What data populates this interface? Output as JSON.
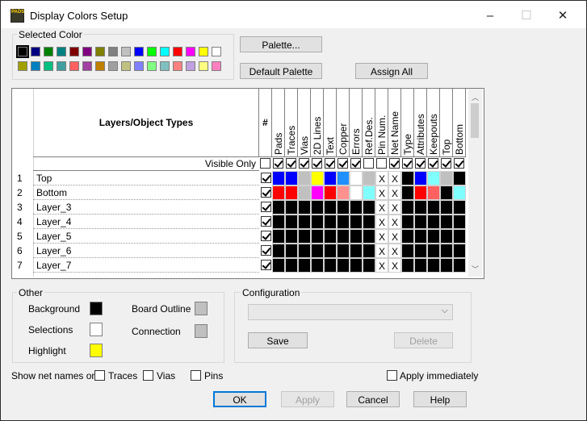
{
  "window": {
    "title": "Display Colors Setup",
    "app_icon_text": "PADS",
    "minimize": "–",
    "maximize": "☐",
    "close": "✕"
  },
  "selected_color": {
    "label": "Selected Color",
    "row1": [
      "#000000",
      "#000080",
      "#008000",
      "#008080",
      "#800000",
      "#800080",
      "#808000",
      "#808080",
      "#c0c0c0",
      "#0000ff",
      "#00ff00",
      "#00ffff",
      "#ff0000",
      "#ff00ff",
      "#ffff00",
      "#ffffff"
    ],
    "row2": [
      "#a0a000",
      "#0080c0",
      "#00c080",
      "#40a0a0",
      "#ff6060",
      "#a040a0",
      "#c08000",
      "#a0a0a0",
      "#c0c080",
      "#8080ff",
      "#80ff80",
      "#80c0c0",
      "#ff8080",
      "#c0a0e0",
      "#ffff80",
      "#ff80c0"
    ]
  },
  "buttons": {
    "palette": "Palette...",
    "default_palette": "Default Palette",
    "assign_all": "Assign All",
    "ok": "OK",
    "apply": "Apply",
    "cancel": "Cancel",
    "help": "Help",
    "save": "Save",
    "delete": "Delete"
  },
  "grid": {
    "header_title": "Layers/Object Types",
    "hash": "#",
    "columns": [
      "Pads",
      "Traces",
      "Vias",
      "2D Lines",
      "Text",
      "Copper",
      "Errors",
      "Ref.Des.",
      "Pin Num.",
      "Net Name",
      "Type",
      "Attributes",
      "Keepouts",
      "Top",
      "Bottom"
    ],
    "visible_only": "Visible Only",
    "x_mark": "X",
    "rows": [
      {
        "num": "1",
        "name": "Top",
        "colors": [
          "#0000ff",
          "#0000ff",
          "#c0c0c0",
          "#ffff00",
          "#0000ff",
          "#2090ff",
          "#ffffff",
          "#c0c0c0",
          "X",
          "X",
          "#000000",
          "#0000ff",
          "#80ffff",
          "#c0c0c0",
          "#000000"
        ]
      },
      {
        "num": "2",
        "name": "Bottom",
        "colors": [
          "#ff0000",
          "#ff0000",
          "#c0c0c0",
          "#ff00ff",
          "#ff0000",
          "#ff9090",
          "#ffffff",
          "#80ffff",
          "X",
          "X",
          "#000000",
          "#ff0000",
          "#ff6060",
          "#000000",
          "#80ffff"
        ]
      },
      {
        "num": "3",
        "name": "Layer_3",
        "colors": [
          "#000000",
          "#000000",
          "#000000",
          "#000000",
          "#000000",
          "#000000",
          "#000000",
          "#000000",
          "X",
          "X",
          "#000000",
          "#000000",
          "#000000",
          "#000000",
          "#000000"
        ]
      },
      {
        "num": "4",
        "name": "Layer_4",
        "colors": [
          "#000000",
          "#000000",
          "#000000",
          "#000000",
          "#000000",
          "#000000",
          "#000000",
          "#000000",
          "X",
          "X",
          "#000000",
          "#000000",
          "#000000",
          "#000000",
          "#000000"
        ]
      },
      {
        "num": "5",
        "name": "Layer_5",
        "colors": [
          "#000000",
          "#000000",
          "#000000",
          "#000000",
          "#000000",
          "#000000",
          "#000000",
          "#000000",
          "X",
          "X",
          "#000000",
          "#000000",
          "#000000",
          "#000000",
          "#000000"
        ]
      },
      {
        "num": "6",
        "name": "Layer_6",
        "colors": [
          "#000000",
          "#000000",
          "#000000",
          "#000000",
          "#000000",
          "#000000",
          "#000000",
          "#000000",
          "X",
          "X",
          "#000000",
          "#000000",
          "#000000",
          "#000000",
          "#000000"
        ]
      },
      {
        "num": "7",
        "name": "Layer_7",
        "colors": [
          "#000000",
          "#000000",
          "#000000",
          "#000000",
          "#000000",
          "#000000",
          "#000000",
          "#000000",
          "X",
          "X",
          "#000000",
          "#000000",
          "#000000",
          "#000000",
          "#000000"
        ]
      }
    ]
  },
  "other": {
    "label": "Other",
    "background": "Background",
    "background_color": "#000000",
    "selections": "Selections",
    "selections_color": "#ffffff",
    "highlight": "Highlight",
    "highlight_color": "#ffff00",
    "board_outline": "Board Outline",
    "board_outline_color": "#c0c0c0",
    "connection": "Connection",
    "connection_color": "#c0c0c0"
  },
  "configuration": {
    "label": "Configuration",
    "value": ""
  },
  "net_names": {
    "label": "Show net names on",
    "traces": "Traces",
    "vias": "Vias",
    "pins": "Pins",
    "apply_immediately": "Apply immediately"
  }
}
